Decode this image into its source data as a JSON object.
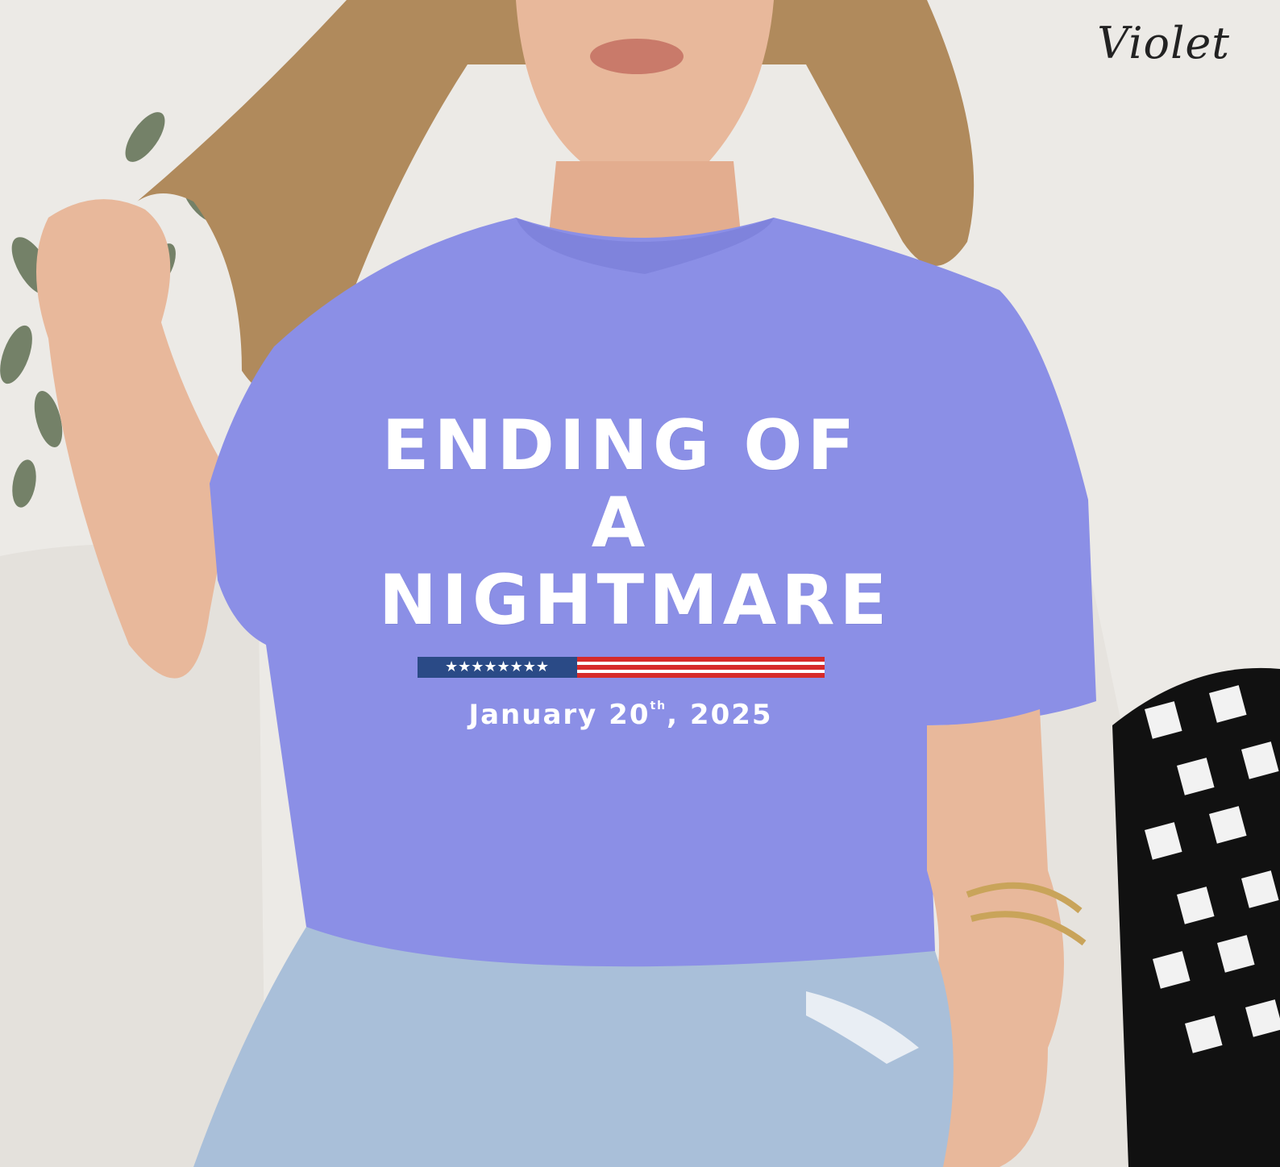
{
  "color_label": "Violet",
  "shirt_print": {
    "headline_line1": "ENDING OF A",
    "headline_line2": "NIGHTMARE",
    "date_main": "January 20",
    "date_suffix": "th",
    "date_year": ", 2025",
    "flag_stars": "★★★★★★★★"
  },
  "colors": {
    "shirt": "#8b8fe6",
    "wall": "#eceae6",
    "couch": "#e4e1dc",
    "jeans": "#a9bfd9",
    "hair": "#b08a5c",
    "skin": "#e8b89b",
    "flag_blue": "#2a4a86",
    "flag_red": "#d62a2a"
  }
}
